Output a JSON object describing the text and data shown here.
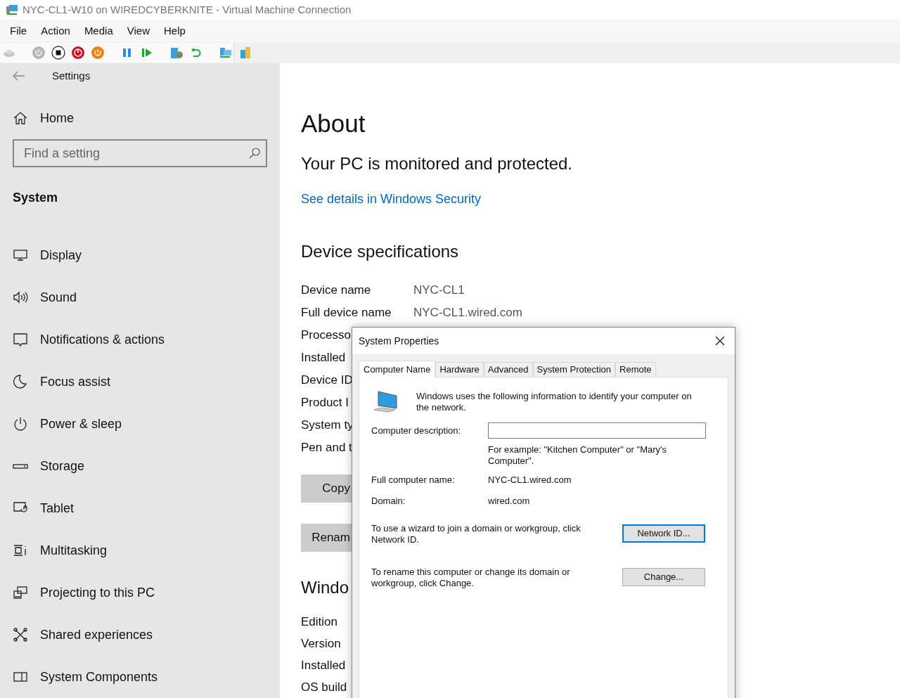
{
  "window": {
    "title": "NYC-CL1-W10 on WIREDCYBERKNITE - Virtual Machine Connection"
  },
  "menu": [
    "File",
    "Action",
    "Media",
    "View",
    "Help"
  ],
  "toolbar": [
    {
      "kind": "ctrl-alt-del"
    },
    {
      "kind": "sep"
    },
    {
      "kind": "start"
    },
    {
      "kind": "turn-off"
    },
    {
      "kind": "shutdown"
    },
    {
      "kind": "save"
    },
    {
      "kind": "sep"
    },
    {
      "kind": "pause"
    },
    {
      "kind": "resume"
    },
    {
      "kind": "sep"
    },
    {
      "kind": "checkpoint"
    },
    {
      "kind": "revert"
    },
    {
      "kind": "sep"
    },
    {
      "kind": "enhanced"
    },
    {
      "kind": "share"
    }
  ],
  "sidebar": {
    "title": "Settings",
    "home": "Home",
    "search": {
      "placeholder": "Find a setting"
    },
    "section": "System",
    "items": [
      {
        "label": "Display"
      },
      {
        "label": "Sound"
      },
      {
        "label": "Notifications & actions"
      },
      {
        "label": "Focus assist"
      },
      {
        "label": "Power & sleep"
      },
      {
        "label": "Storage"
      },
      {
        "label": "Tablet"
      },
      {
        "label": "Multitasking"
      },
      {
        "label": "Projecting to this PC"
      },
      {
        "label": "Shared experiences"
      },
      {
        "label": "System Components"
      }
    ]
  },
  "main": {
    "title": "About",
    "status": "Your PC is monitored and protected.",
    "link": "See details in Windows Security",
    "specs_title": "Device specifications",
    "specs": [
      {
        "label": "Device name",
        "value": "NYC-CL1"
      },
      {
        "label": "Full device name",
        "value": "NYC-CL1.wired.com"
      },
      {
        "label": "Processo"
      },
      {
        "label": "Installed"
      },
      {
        "label": "Device ID"
      },
      {
        "label": "Product I"
      },
      {
        "label": "System ty"
      },
      {
        "label": "Pen and t"
      }
    ],
    "buttons": [
      "Copy",
      "Renam"
    ],
    "windows_title": "Windo",
    "windows_specs": [
      "Edition",
      "Version",
      "Installed",
      "OS build"
    ]
  },
  "dialog": {
    "title": "System Properties",
    "tabs": [
      {
        "label": "Computer Name",
        "selected": true
      },
      {
        "label": "Hardware",
        "selected": false
      },
      {
        "label": "Advanced",
        "selected": false
      },
      {
        "label": "System Protection",
        "selected": false
      },
      {
        "label": "Remote",
        "selected": false
      }
    ],
    "intro": "Windows uses the following information to identify your computer on the network.",
    "description": {
      "label": "Computer description:"
    },
    "example": "For example: \"Kitchen Computer\" or \"Mary's Computer\".",
    "fields": [
      {
        "label": "Full computer name:",
        "value": "NYC-CL1.wired.com"
      },
      {
        "label": "Domain:",
        "value": "wired.com"
      }
    ],
    "actions": [
      {
        "text": "To use a wizard to join a domain or workgroup, click Network ID.",
        "button": "Network ID...",
        "focused": true
      },
      {
        "text": "To rename this computer or change its domain or workgroup, click Change.",
        "button": "Change...",
        "focused": false
      }
    ]
  }
}
